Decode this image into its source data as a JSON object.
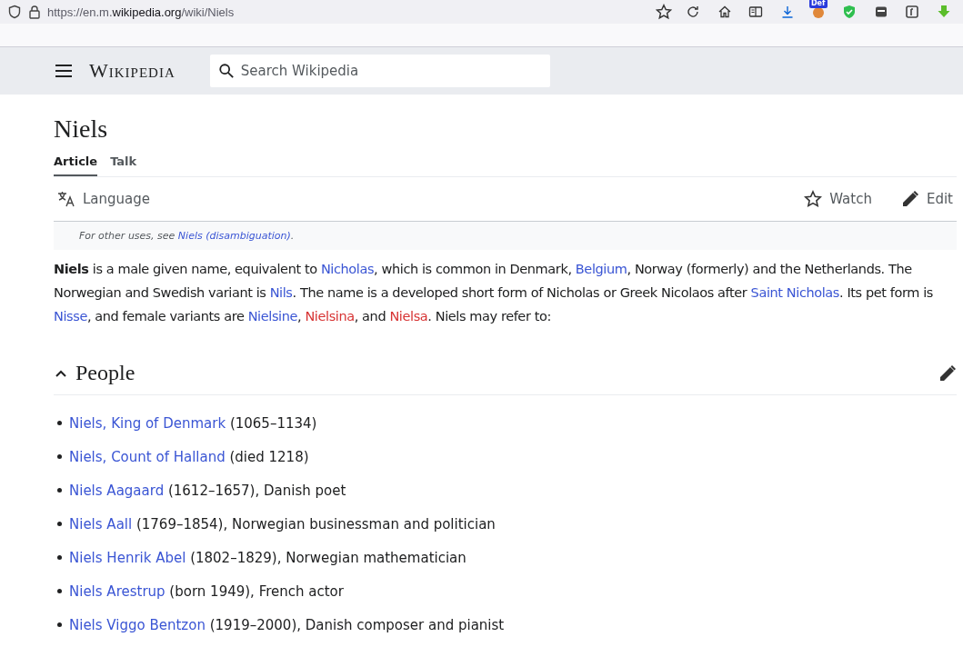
{
  "browser": {
    "url": {
      "scheme": "https://en.m.",
      "domain": "wikipedia.org",
      "path": "/wiki/Niels"
    },
    "extension_badge": "Def"
  },
  "header": {
    "logo": "Wikipedia",
    "search": {
      "placeholder": "Search Wikipedia"
    }
  },
  "page": {
    "title": "Niels",
    "tabs": [
      {
        "label": "Article",
        "selected": true
      },
      {
        "label": "Talk",
        "selected": false
      }
    ],
    "actions": {
      "language": "Language",
      "watch": "Watch",
      "edit": "Edit"
    },
    "hatnote": [
      {
        "kind": "text",
        "text": "For other uses, see "
      },
      {
        "kind": "link",
        "text": "Niels (disambiguation)"
      },
      {
        "kind": "text",
        "text": "."
      }
    ],
    "intro": [
      {
        "kind": "bold",
        "text": "Niels"
      },
      {
        "kind": "text",
        "text": " is a male given name, equivalent to "
      },
      {
        "kind": "link",
        "text": "Nicholas"
      },
      {
        "kind": "text",
        "text": ", which is common in Denmark, "
      },
      {
        "kind": "link",
        "text": "Belgium"
      },
      {
        "kind": "text",
        "text": ", Norway (formerly) and the Netherlands. The Norwegian and Swedish variant is "
      },
      {
        "kind": "link",
        "text": "Nils"
      },
      {
        "kind": "text",
        "text": ". The name is a developed short form of Nicholas or Greek Nicolaos after "
      },
      {
        "kind": "link",
        "text": "Saint Nicholas"
      },
      {
        "kind": "text",
        "text": ". Its pet form is "
      },
      {
        "kind": "link",
        "text": "Nisse"
      },
      {
        "kind": "text",
        "text": ", and female variants are "
      },
      {
        "kind": "link",
        "text": "Nielsine"
      },
      {
        "kind": "text",
        "text": ", "
      },
      {
        "kind": "redlink",
        "text": "Nielsina"
      },
      {
        "kind": "text",
        "text": ", and "
      },
      {
        "kind": "redlink",
        "text": "Nielsa"
      },
      {
        "kind": "text",
        "text": ". Niels may refer to:"
      }
    ],
    "section": {
      "title": "People",
      "expanded": true,
      "items": [
        {
          "link": "Niels, King of Denmark",
          "rest": " (1065–1134)"
        },
        {
          "link": "Niels, Count of Halland",
          "rest": " (died 1218)"
        },
        {
          "link": "Niels Aagaard",
          "rest": " (1612–1657), Danish poet"
        },
        {
          "link": "Niels Aall",
          "rest": " (1769–1854), Norwegian businessman and politician"
        },
        {
          "link": "Niels Henrik Abel",
          "rest": " (1802–1829), Norwegian mathematician"
        },
        {
          "link": "Niels Arestrup",
          "rest": " (born 1949), French actor"
        },
        {
          "link": "Niels Viggo Bentzon",
          "rest": " (1919–2000), Danish composer and pianist"
        }
      ]
    }
  }
}
